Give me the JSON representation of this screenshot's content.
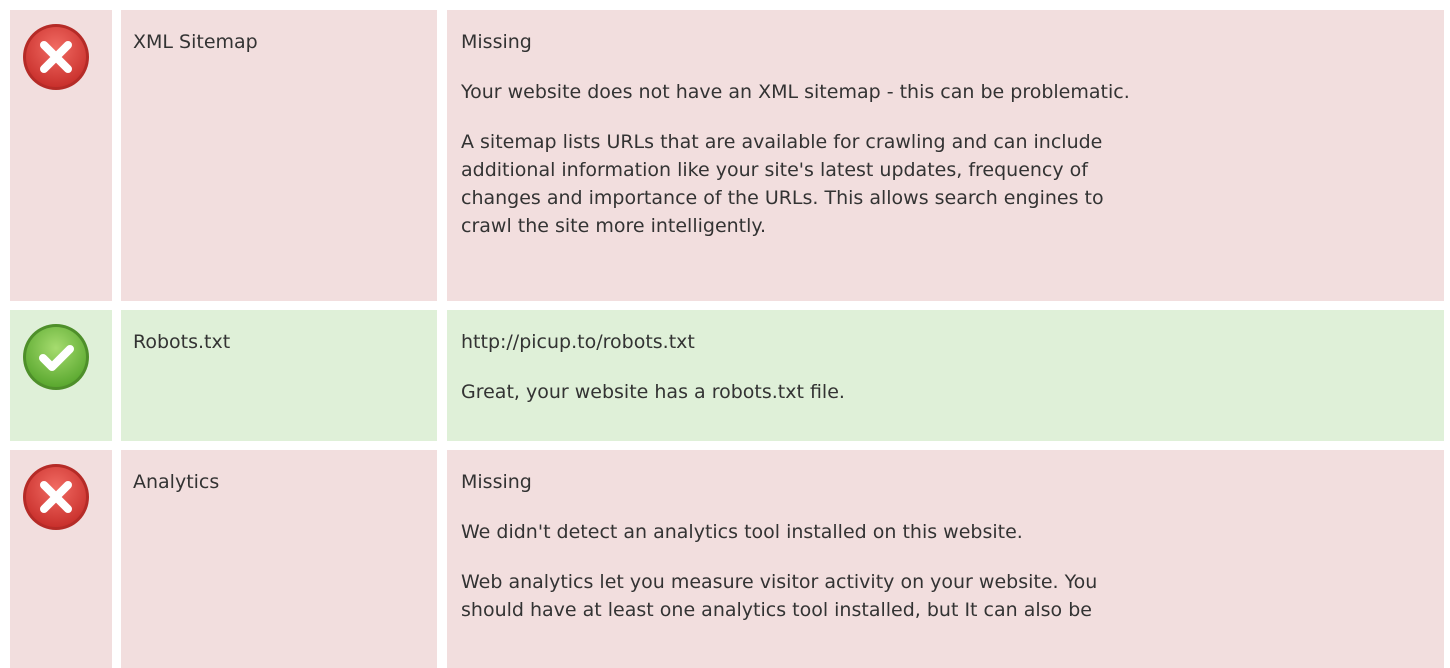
{
  "rows": [
    {
      "status": "error",
      "icon": "error-x-icon",
      "name": "XML Sitemap",
      "value": "Missing",
      "lines": [
        "Your website does not have an XML sitemap - this can be problematic.",
        "A sitemap lists URLs that are available for crawling and can include",
        "additional information like your site's latest updates, frequency of",
        "changes and importance of the URLs. This allows search engines to",
        "crawl the site more intelligently."
      ]
    },
    {
      "status": "ok",
      "icon": "check-icon",
      "name": "Robots.txt",
      "value": "http://picup.to/robots.txt",
      "lines": [
        "Great, your website has a robots.txt file."
      ]
    },
    {
      "status": "error",
      "icon": "error-x-icon",
      "name": "Analytics",
      "value": "Missing",
      "lines": [
        "We didn't detect an analytics tool installed on this website.",
        "Web analytics let you measure visitor activity on your website. You",
        "should have at least one analytics tool installed, but It can also be"
      ]
    }
  ],
  "colors": {
    "error_bg": "#f2dede",
    "ok_bg": "#dff0d8",
    "error_icon": "#e0473f",
    "ok_icon": "#79c34a"
  }
}
